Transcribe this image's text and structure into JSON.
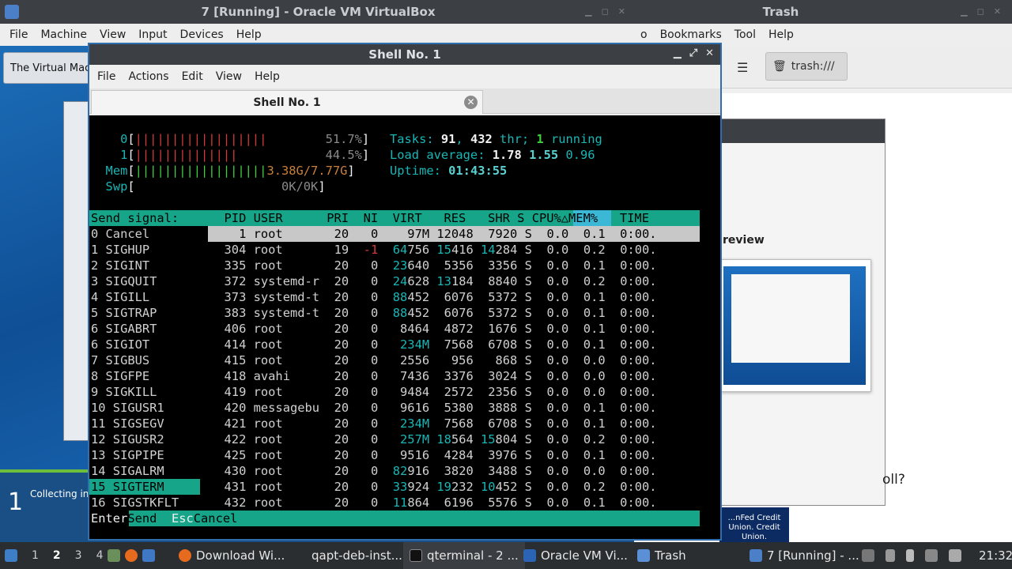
{
  "vbox": {
    "title": "7 [Running] - Oracle VM VirtualBox",
    "menu": [
      "File",
      "Machine",
      "View",
      "Input",
      "Devices",
      "Help"
    ],
    "guest_note": "The Virtual Mach",
    "guest_step": "1",
    "guest_status": "Collecting inf"
  },
  "trash": {
    "title": "Trash",
    "menu": [
      "o",
      "Bookmarks",
      "Tool",
      "Help"
    ],
    "path": "trash:///",
    "preview_label": "review",
    "poll_text": "oll?",
    "credit_union": "...nFed Credit Union. Credit Union."
  },
  "qterminal": {
    "title": "Shell No. 1",
    "menu": [
      "File",
      "Actions",
      "Edit",
      "View",
      "Help"
    ],
    "tab_label": "Shell No. 1"
  },
  "htop": {
    "cpu0_label": "0",
    "cpu0_bar": "||||||||||||||||||",
    "cpu0_pct": "51.7%",
    "cpu1_label": "1",
    "cpu1_bar": "||||||||||||||",
    "cpu1_pct": "44.5%",
    "mem_bar": "||||||||||||||||||",
    "mem_val": "3.38G/7.77G",
    "swp_val": "0K/0K",
    "tasks": "91",
    "threads": "432",
    "running": "1",
    "load1": "1.78",
    "load5": "1.55",
    "load15": "0.96",
    "uptime": "01:43:55",
    "signal_header": "Send signal:",
    "columns": "  PID USER      PRI  NI  VIRT   RES   SHR S CPU%△MEM%   TIME",
    "signals": [
      "0 Cancel",
      "1 SIGHUP",
      "2 SIGINT",
      "3 SIGQUIT",
      "4 SIGILL",
      "5 SIGTRAP",
      "6 SIGABRT",
      "6 SIGIOT",
      "7 SIGBUS",
      "8 SIGFPE",
      "9 SIGKILL",
      "10 SIGUSR1",
      "11 SIGSEGV",
      "12 SIGUSR2",
      "13 SIGPIPE",
      "14 SIGALRM",
      "15 SIGTERM",
      "16 SIGSTKFLT"
    ],
    "processes": [
      {
        "pid": "1",
        "user": "root",
        "pri": "20",
        "ni": "0",
        "virt": "97M",
        "res": "12048",
        "shr": "7920",
        "s": "S",
        "cpu": "0.0",
        "mem": "0.1",
        "time": "0:00."
      },
      {
        "pid": "304",
        "user": "root",
        "pri": "19",
        "ni": "-1",
        "virt": "64756",
        "res": "15416",
        "shr": "14284",
        "s": "S",
        "cpu": "0.0",
        "mem": "0.2",
        "time": "0:00."
      },
      {
        "pid": "335",
        "user": "root",
        "pri": "20",
        "ni": "0",
        "virt": "23640",
        "res": "5356",
        "shr": "3356",
        "s": "S",
        "cpu": "0.0",
        "mem": "0.1",
        "time": "0:00."
      },
      {
        "pid": "372",
        "user": "systemd-r",
        "pri": "20",
        "ni": "0",
        "virt": "24628",
        "res": "13184",
        "shr": "8840",
        "s": "S",
        "cpu": "0.0",
        "mem": "0.2",
        "time": "0:00."
      },
      {
        "pid": "373",
        "user": "systemd-t",
        "pri": "20",
        "ni": "0",
        "virt": "88452",
        "res": "6076",
        "shr": "5372",
        "s": "S",
        "cpu": "0.0",
        "mem": "0.1",
        "time": "0:00."
      },
      {
        "pid": "383",
        "user": "systemd-t",
        "pri": "20",
        "ni": "0",
        "virt": "88452",
        "res": "6076",
        "shr": "5372",
        "s": "S",
        "cpu": "0.0",
        "mem": "0.1",
        "time": "0:00."
      },
      {
        "pid": "406",
        "user": "root",
        "pri": "20",
        "ni": "0",
        "virt": "8464",
        "res": "4872",
        "shr": "1676",
        "s": "S",
        "cpu": "0.0",
        "mem": "0.1",
        "time": "0:00."
      },
      {
        "pid": "414",
        "user": "root",
        "pri": "20",
        "ni": "0",
        "virt": "234M",
        "res": "7568",
        "shr": "6708",
        "s": "S",
        "cpu": "0.0",
        "mem": "0.1",
        "time": "0:00."
      },
      {
        "pid": "415",
        "user": "root",
        "pri": "20",
        "ni": "0",
        "virt": "2556",
        "res": "956",
        "shr": "868",
        "s": "S",
        "cpu": "0.0",
        "mem": "0.0",
        "time": "0:00."
      },
      {
        "pid": "418",
        "user": "avahi",
        "pri": "20",
        "ni": "0",
        "virt": "7436",
        "res": "3376",
        "shr": "3024",
        "s": "S",
        "cpu": "0.0",
        "mem": "0.0",
        "time": "0:00."
      },
      {
        "pid": "419",
        "user": "root",
        "pri": "20",
        "ni": "0",
        "virt": "9484",
        "res": "2572",
        "shr": "2356",
        "s": "S",
        "cpu": "0.0",
        "mem": "0.0",
        "time": "0:00."
      },
      {
        "pid": "420",
        "user": "messagebu",
        "pri": "20",
        "ni": "0",
        "virt": "9616",
        "res": "5380",
        "shr": "3888",
        "s": "S",
        "cpu": "0.0",
        "mem": "0.1",
        "time": "0:00."
      },
      {
        "pid": "421",
        "user": "root",
        "pri": "20",
        "ni": "0",
        "virt": "234M",
        "res": "7568",
        "shr": "6708",
        "s": "S",
        "cpu": "0.0",
        "mem": "0.1",
        "time": "0:00."
      },
      {
        "pid": "422",
        "user": "root",
        "pri": "20",
        "ni": "0",
        "virt": "257M",
        "res": "18564",
        "shr": "15804",
        "s": "S",
        "cpu": "0.0",
        "mem": "0.2",
        "time": "0:00."
      },
      {
        "pid": "425",
        "user": "root",
        "pri": "20",
        "ni": "0",
        "virt": "9516",
        "res": "4284",
        "shr": "3976",
        "s": "S",
        "cpu": "0.0",
        "mem": "0.1",
        "time": "0:00."
      },
      {
        "pid": "430",
        "user": "root",
        "pri": "20",
        "ni": "0",
        "virt": "82916",
        "res": "3820",
        "shr": "3488",
        "s": "S",
        "cpu": "0.0",
        "mem": "0.0",
        "time": "0:00."
      },
      {
        "pid": "431",
        "user": "root",
        "pri": "20",
        "ni": "0",
        "virt": "33924",
        "res": "19232",
        "shr": "10452",
        "s": "S",
        "cpu": "0.0",
        "mem": "0.2",
        "time": "0:00."
      },
      {
        "pid": "432",
        "user": "root",
        "pri": "20",
        "ni": "0",
        "virt": "11864",
        "res": "6196",
        "shr": "5576",
        "s": "S",
        "cpu": "0.0",
        "mem": "0.1",
        "time": "0:00."
      }
    ],
    "footer_key1": "Enter",
    "footer_act1": "Send  ",
    "footer_key2": "Esc",
    "footer_act2": "Cancel"
  },
  "taskbar": {
    "desktops": [
      "1",
      "2",
      "3",
      "4"
    ],
    "active_desktop": "2",
    "tasks": [
      "Download Wi...",
      "qapt-deb-inst...",
      "qterminal - 2 ...",
      "Oracle VM Vi...",
      "Trash",
      "7 [Running] - ..."
    ],
    "clock": "21:32"
  },
  "colors": {
    "htop_accent": "#17a589",
    "titlebar": "#3c3f43",
    "active_border": "#2f6fb0"
  }
}
